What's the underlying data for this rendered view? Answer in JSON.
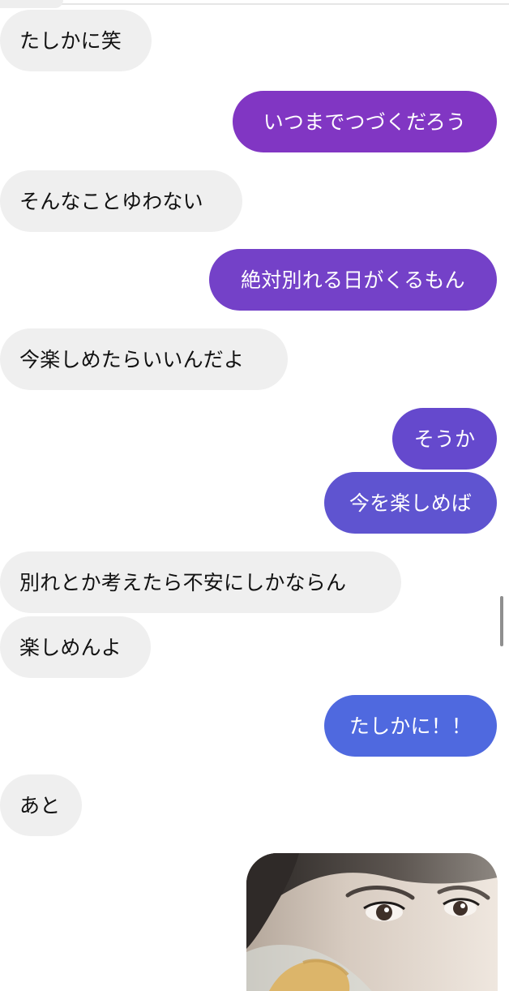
{
  "messages": [
    {
      "side": "received",
      "text": "たしかに笑"
    },
    {
      "side": "sent",
      "text": "いつまでつづくだろう",
      "color": "#8136c3"
    },
    {
      "side": "received",
      "text": "そんなことゆわない"
    },
    {
      "side": "sent",
      "text": "絶対別れる日がくるもん",
      "color": "#7441c8"
    },
    {
      "side": "received",
      "text": "今楽しめたらいいんだよ"
    },
    {
      "side": "sent",
      "text": "そうか",
      "color": "#6549cd"
    },
    {
      "side": "sent",
      "text": "今を楽しめば",
      "color": "#5f54d0"
    },
    {
      "side": "received",
      "text": "別れとか考えたら不安にしかならん"
    },
    {
      "side": "received",
      "text": "楽しめんよ"
    },
    {
      "side": "sent",
      "text": "たしかに！！",
      "color": "#4f69df"
    },
    {
      "side": "received",
      "text": "あと"
    }
  ],
  "colors": {
    "received_bubble": "#efefef",
    "received_text": "#111111",
    "sent_text": "#ffffff"
  }
}
